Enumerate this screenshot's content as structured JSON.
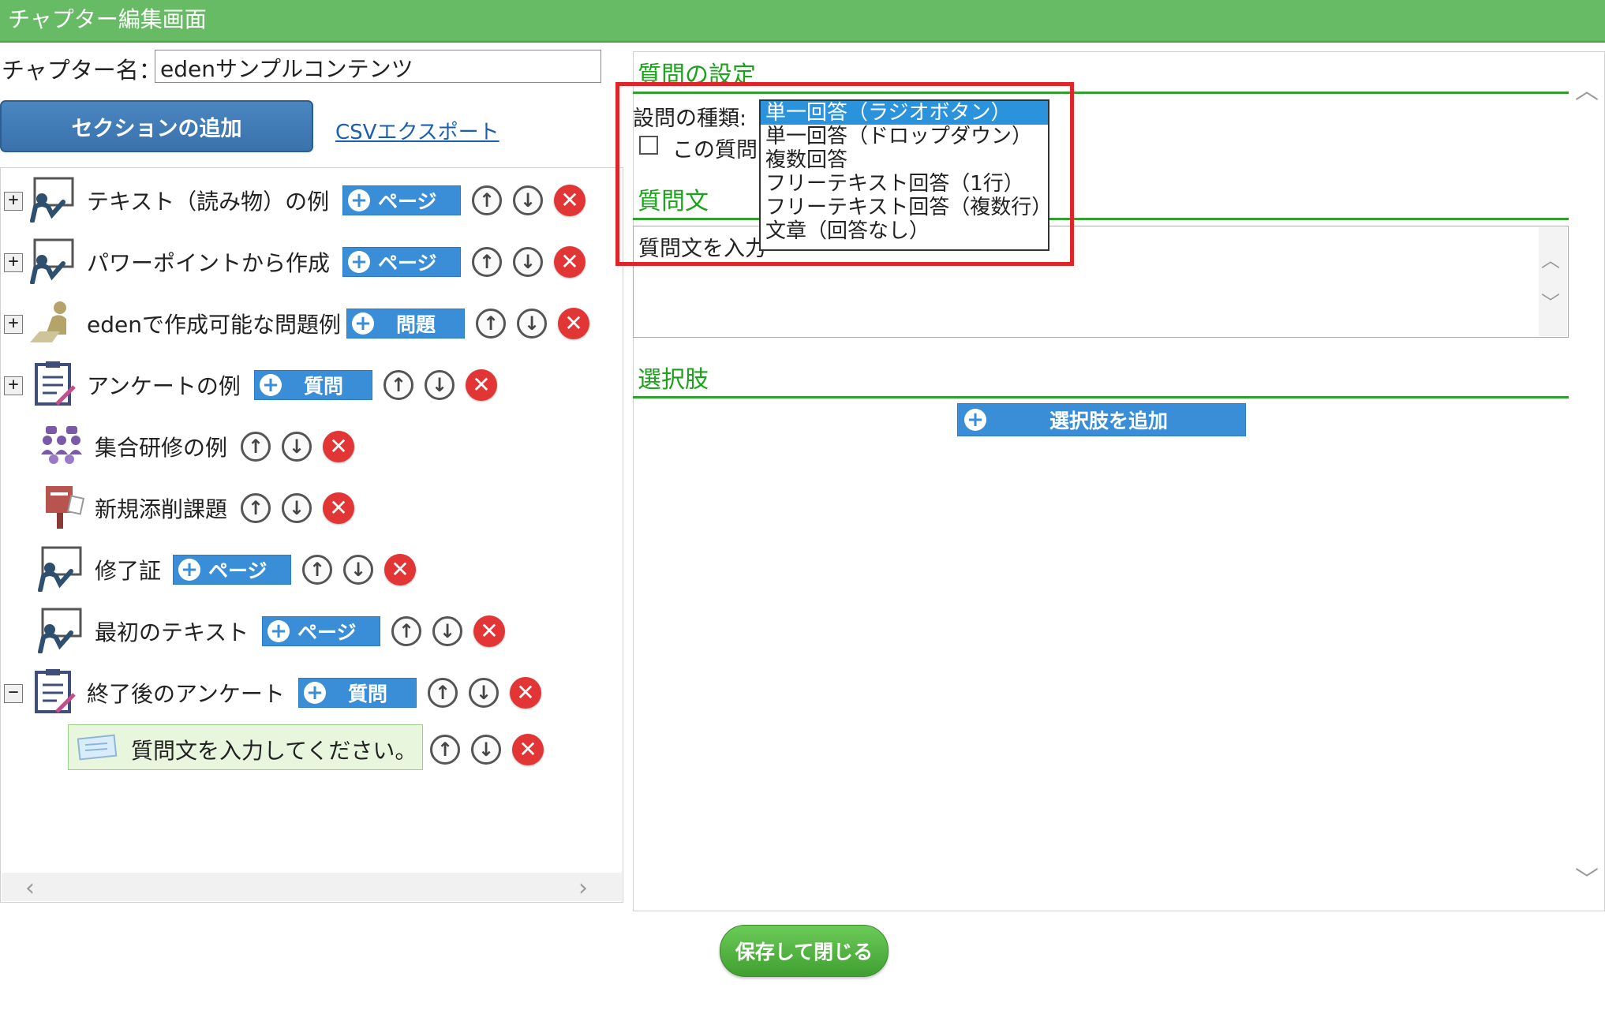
{
  "window": {
    "title": "チャプター編集画面"
  },
  "chapter": {
    "name_label": "チャプター名：",
    "name_value": "edenサンプルコンテンツ"
  },
  "toolbar": {
    "add_section": "セクションの追加",
    "csv_export": "CSVエクスポート"
  },
  "tree": {
    "items": [
      {
        "label": "テキスト（読み物）の例",
        "icon": "teacher-icon",
        "expander": "+",
        "pill": "ページ"
      },
      {
        "label": "パワーポイントから作成",
        "icon": "teacher-icon",
        "expander": "+",
        "pill": "ページ"
      },
      {
        "label": "edenで作成可能な問題例",
        "icon": "exam-desk-icon",
        "expander": "+",
        "pill": "問題"
      },
      {
        "label": "アンケートの例",
        "icon": "clipboard-icon",
        "expander": "+",
        "pill": "質問"
      },
      {
        "label": "集合研修の例",
        "icon": "group-training-icon",
        "expander": "",
        "pill": ""
      },
      {
        "label": "新規添削課題",
        "icon": "post-box-icon",
        "expander": "",
        "pill": ""
      },
      {
        "label": "修了証",
        "icon": "teacher-icon",
        "expander": "",
        "pill": "ページ"
      },
      {
        "label": "最初のテキスト",
        "icon": "teacher-icon",
        "expander": "",
        "pill": "ページ"
      },
      {
        "label": "終了後のアンケート",
        "icon": "clipboard-icon",
        "expander": "−",
        "pill": "質問"
      }
    ],
    "child_question": "質問文を入力してください。"
  },
  "question_settings": {
    "title": "質問の設定",
    "type_label": "設問の種類:",
    "checkbox_label": "この質問",
    "type_options": [
      "単一回答（ラジオボタン）",
      "単一回答（ドロップダウン）",
      "複数回答",
      "フリーテキスト回答（1行）",
      "フリーテキスト回答（複数行）",
      "文章（回答なし）"
    ],
    "selected_index": 0,
    "question_text_title": "質問文",
    "question_text_value": "質問文を入力",
    "choices_title": "選択肢",
    "add_choice": "選択肢を追加"
  },
  "footer": {
    "save_close": "保存して閉じる"
  },
  "colors": {
    "titlebar": "#68bb65",
    "pill_blue": "#3a8ed8",
    "section_green": "#1aa31a",
    "highlight_red": "#e0242a",
    "delete_red": "#e23535"
  }
}
